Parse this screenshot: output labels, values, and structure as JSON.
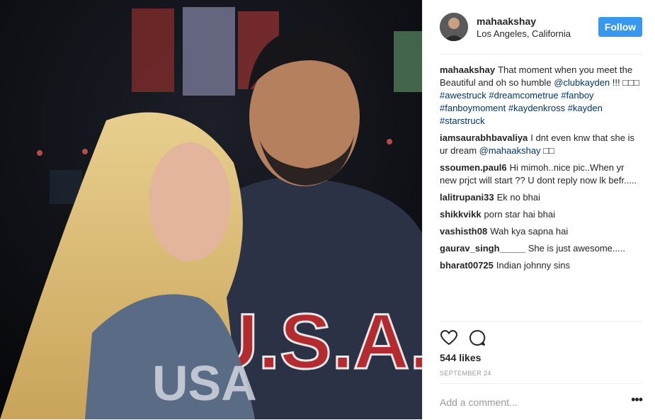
{
  "post": {
    "username": "mahaakshay",
    "location": "Los Angeles, California",
    "follow_label": "Follow"
  },
  "caption": {
    "username": "mahaakshay",
    "text_1": "That moment when you meet the Beautiful and oh so humble",
    "mention": "@clubkayden",
    "text_2": "!!! □□□",
    "tags": [
      "#awestruck",
      "#dreamcometrue",
      "#fanboy",
      "#fanboymoment",
      "#kaydenkross",
      "#kayden",
      "#starstruck"
    ]
  },
  "comments": [
    {
      "username": "iamsaurabhbavaliya",
      "text": "I dnt even knw that she is ur dream",
      "mention": "@mahaakshay",
      "suffix": " □□"
    },
    {
      "username": "ssoumen.paul6",
      "text": "Hi mimoh..nice pic..When yr new prjct will start ?? U dont reply now lk befr....."
    },
    {
      "username": "lalitrupani33",
      "text": "Ek no bhai"
    },
    {
      "username": "shikkvikk",
      "text": "porn star hai bhai"
    },
    {
      "username": "vashisth08",
      "text": "Wah kya sapna hai"
    },
    {
      "username": "gaurav_singh_____",
      "text": "She is just awesome....."
    },
    {
      "username": "bharat00725",
      "text": "Indian johnny sins"
    }
  ],
  "icons": {
    "like": "heart-icon",
    "comment": "comment-bubble-icon",
    "more": "more-options-icon"
  },
  "likes_label": "544 likes",
  "date_label": "SEPTEMBER 24",
  "add_comment_placeholder": "Add a comment...",
  "more_label": "•••",
  "colors": {
    "follow": "#3897f0",
    "link": "#003569",
    "date": "#999999"
  },
  "photo": {
    "shirt_text": "U.S.A.",
    "shirt_text_2": "USA"
  }
}
